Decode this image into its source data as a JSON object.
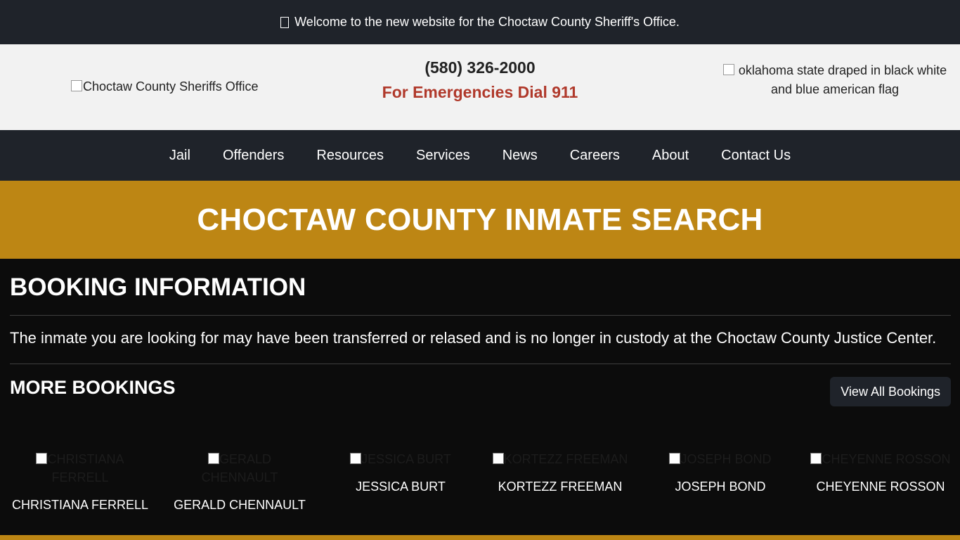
{
  "announcement": {
    "text": "Welcome to the new website for the Choctaw County Sheriff's Office."
  },
  "header": {
    "logo_alt": "Choctaw County Sheriffs Office",
    "phone": "(580) 326-2000",
    "emergency": "For Emergencies Dial 911",
    "flag_alt": "oklahoma state draped in black white and blue american flag"
  },
  "nav": {
    "items": [
      "Jail",
      "Offenders",
      "Resources",
      "Services",
      "News",
      "Careers",
      "About",
      "Contact Us"
    ]
  },
  "banner": {
    "title": "CHOCTAW COUNTY INMATE SEARCH"
  },
  "booking": {
    "heading": "BOOKING INFORMATION",
    "message": "The inmate you are looking for may have been transferred or relased and is no longer in custody at the Choctaw County Justice Center."
  },
  "more": {
    "heading": "MORE BOOKINGS",
    "view_all_label": "View All Bookings",
    "bookings": [
      {
        "name": "CHRISTIANA FERRELL",
        "img_alt": "CHRISTIANA FERRELL"
      },
      {
        "name": "GERALD CHENNAULT",
        "img_alt": "GERALD CHENNAULT"
      },
      {
        "name": "JESSICA BURT",
        "img_alt": "JESSICA BURT"
      },
      {
        "name": "KORTEZZ FREEMAN",
        "img_alt": "KORTEZZ FREEMAN"
      },
      {
        "name": "JOSEPH BOND",
        "img_alt": "JOSEPH BOND"
      },
      {
        "name": "CHEYENNE ROSSON",
        "img_alt": "CHEYENNE ROSSON"
      }
    ]
  },
  "colors": {
    "dark": "#1f232a",
    "gold": "#bd8614",
    "emergency_red": "#b0392b",
    "page_bg": "#0c0c0c"
  }
}
